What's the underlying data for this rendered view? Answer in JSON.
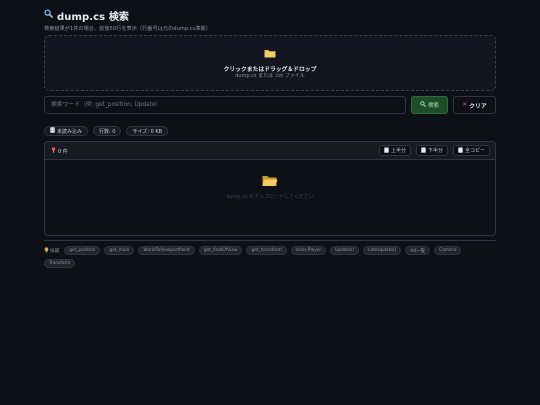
{
  "header": {
    "icon": "search-icon",
    "title": "dump.cs 検索",
    "subtitle": "検索結果が1件の場合、前後50行を表示（行番号は元のdump.cs準拠）"
  },
  "dropzone": {
    "icon": "folder-icon",
    "title": "クリックまたはドラッグ＆ドロップ",
    "subtitle": "dump.cs または .txt ファイル"
  },
  "search": {
    "placeholder": "検索ワード（例: get_position, Update）",
    "value": "",
    "search_button_label": "検索",
    "clear_button_label": "クリア"
  },
  "stats": {
    "file_status": "未読み込み",
    "lines": "行数: 0",
    "size": "サイズ: 0 KB"
  },
  "results": {
    "count": "0 件",
    "upper_half_label": "上半分",
    "lower_half_label": "下半分",
    "copy_all_label": "全コピー",
    "empty_message": "dump.cs をアップロードしてください"
  },
  "examples": {
    "label": "候補",
    "items": [
      "get_position",
      "get_main",
      "WorldToViewportPoint",
      "get_fieldOfView",
      "get_transform",
      "class Player",
      "Update()",
      "LateUpdate()",
      "Hit一覧",
      "Camera",
      "Transform"
    ]
  },
  "colors": {
    "background": "#0d1117",
    "panel": "#161b22",
    "border": "#30363d",
    "accent_green": "#1f4d2c",
    "folder_yellow": "#e3b341"
  }
}
